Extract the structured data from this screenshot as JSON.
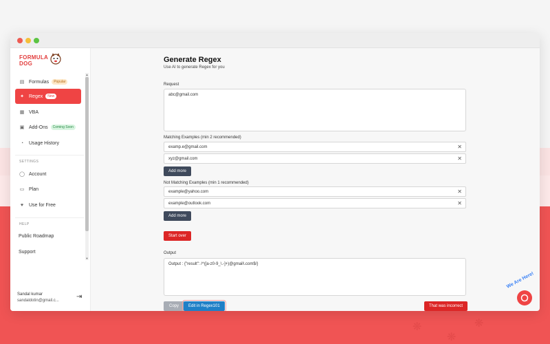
{
  "app": {
    "logo_line1": "FORMULA",
    "logo_line2": "DOG"
  },
  "sidebar": {
    "items": [
      {
        "label": "Formulas",
        "badge": "Popular",
        "icon": "formula-icon"
      },
      {
        "label": "Regex",
        "badge": "New",
        "icon": "regex-icon"
      },
      {
        "label": "VBA",
        "icon": "vba-icon"
      },
      {
        "label": "Add-Ons",
        "badge": "Coming Soon",
        "icon": "addon-icon"
      },
      {
        "label": "Usage History",
        "icon": "history-icon"
      }
    ],
    "settings_label": "SETTINGS",
    "settings_items": [
      {
        "label": "Account",
        "icon": "account-icon"
      },
      {
        "label": "Plan",
        "icon": "plan-icon"
      },
      {
        "label": "Use for Free",
        "icon": "heart-icon"
      }
    ],
    "help_label": "HELP",
    "help_items": [
      {
        "label": "Public Roadmap"
      },
      {
        "label": "Support"
      }
    ],
    "user": {
      "name": "Sandal kumar",
      "email": "sandaldotin@gmail.c..."
    }
  },
  "main": {
    "title": "Generate Regex",
    "subtitle": "Use AI to generate Regex for you",
    "request_label": "Request",
    "request_value": "abc@gmail.com",
    "matching_label": "Matching Examples (min 2 recommended)",
    "matching_examples": [
      "examp.e@gmail.com",
      "xyz@gmail.com"
    ],
    "add_more_label": "Add more",
    "not_matching_label": "Not Matching Examples (min 1 recommended)",
    "not_matching_examples": [
      "example@yahoo.com",
      "example@outlook.com"
    ],
    "start_over_label": "Start over",
    "output_label": "Output",
    "output_value": "Output : {\"result\": /^([a-z0-9_\\.-]+)@gmail\\.com$/}",
    "copy_label": "Copy",
    "edit_label": "Edit in Regex101",
    "incorrect_label": "That was incorrect"
  },
  "chat_widget": {
    "label": "We Are Here!"
  },
  "colors": {
    "accent": "#ef4444",
    "dark_button": "#3f4a5c",
    "blue_button": "#1f80c7"
  }
}
